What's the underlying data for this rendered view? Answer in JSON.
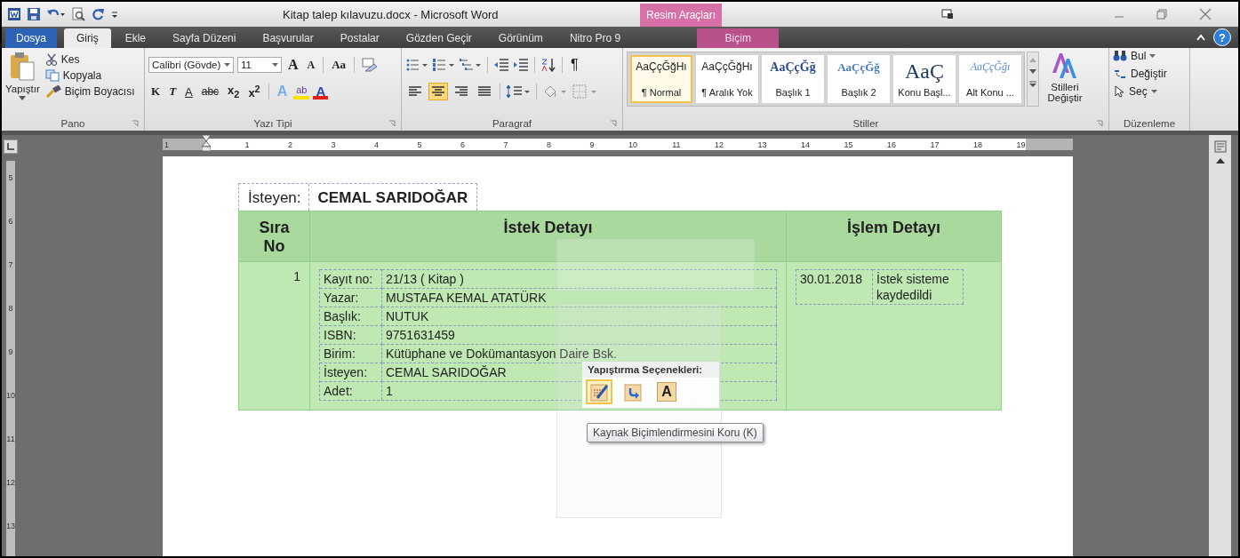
{
  "window": {
    "title": "Kitap talep kılavuzu.docx - Microsoft Word",
    "contextual_group": "Resim Araçları",
    "help": "?"
  },
  "tabs": [
    {
      "label": "Dosya",
      "kind": "file",
      "selected": false
    },
    {
      "label": "Giriş",
      "kind": "tab",
      "selected": true
    },
    {
      "label": "Ekle",
      "kind": "tab",
      "selected": false
    },
    {
      "label": "Sayfa Düzeni",
      "kind": "tab",
      "selected": false
    },
    {
      "label": "Başvurular",
      "kind": "tab",
      "selected": false
    },
    {
      "label": "Postalar",
      "kind": "tab",
      "selected": false
    },
    {
      "label": "Gözden Geçir",
      "kind": "tab",
      "selected": false
    },
    {
      "label": "Görünüm",
      "kind": "tab",
      "selected": false
    },
    {
      "label": "Nitro Pro 9",
      "kind": "tab",
      "selected": false
    },
    {
      "label": "Biçim",
      "kind": "contextual",
      "selected": false
    }
  ],
  "ribbon": {
    "clipboard": {
      "name": "Pano",
      "paste": "Yapıştır",
      "items": [
        "Kes",
        "Kopyala",
        "Biçim Boyacısı"
      ]
    },
    "font": {
      "name": "Yazı Tipi",
      "family": "Calibri (Gövde)",
      "size": "11",
      "row1": [
        "A",
        "A",
        "Aa"
      ],
      "row2": [
        "K",
        "T",
        "A",
        "abc",
        "x$_{2}$",
        "x$^{2}$"
      ],
      "row2b": [
        "A",
        "ab",
        "A"
      ]
    },
    "paragraph": {
      "name": "Paragraf",
      "pilcrow": "¶",
      "align": [
        {
          "kind": "left",
          "selected": false
        },
        {
          "kind": "center",
          "selected": true
        },
        {
          "kind": "right",
          "selected": false
        },
        {
          "kind": "justify",
          "selected": false
        }
      ]
    },
    "styles": {
      "name": "Stiller",
      "items": [
        {
          "preview": "AaÇçĞğHı",
          "label": "¶ Normal",
          "kind": "normal",
          "selected": true
        },
        {
          "preview": "AaÇçĞğHı",
          "label": "¶ Aralık Yok",
          "kind": "normal",
          "selected": false
        },
        {
          "preview": "AaÇçĞğ",
          "label": "Başlık 1",
          "kind": "heading1",
          "selected": false
        },
        {
          "preview": "AaÇçĞğ",
          "label": "Başlık 2",
          "kind": "heading2",
          "selected": false
        },
        {
          "preview": "AaÇ",
          "label": "Konu Başl...",
          "kind": "title",
          "selected": false
        },
        {
          "preview": "AaÇçĞğı",
          "label": "Alt Konu ...",
          "kind": "subtitle",
          "selected": false
        }
      ],
      "change": "Stilleri Değiştir"
    },
    "editing": {
      "name": "Düzenleme",
      "items": [
        "Bul",
        "Değiştir",
        "Seç"
      ]
    }
  },
  "ruler": {
    "negative": "1",
    "marks": [
      "1",
      "2",
      "3",
      "4",
      "5",
      "6",
      "7",
      "8",
      "9",
      "10",
      "11",
      "12",
      "13",
      "14",
      "15",
      "16",
      "17",
      "18",
      "19"
    ],
    "vertical": [
      "5",
      "6",
      "7",
      "8",
      "9",
      "10",
      "11",
      "12",
      "13"
    ]
  },
  "document": {
    "requester_label": "İsteyen:",
    "requester_value": "CEMAL SARIDOĞAR",
    "columns": [
      "Sıra No",
      "İstek Detayı",
      "İşlem Detayı"
    ],
    "rows": [
      {
        "no": "1",
        "details": [
          {
            "label": "Kayıt no:",
            "value": "21/13   ( Kitap )"
          },
          {
            "label": "Yazar:",
            "value": "MUSTAFA KEMAL ATATÜRK"
          },
          {
            "label": "Başlık:",
            "value": "NUTUK"
          },
          {
            "label": "ISBN:",
            "value": "9751631459"
          },
          {
            "label": "Birim:",
            "value": "Kütüphane ve Dokümantasyon Daire Bsk."
          },
          {
            "label": "İsteyen:",
            "value": "CEMAL SARIDOĞAR"
          },
          {
            "label": "Adet:",
            "value": "1"
          }
        ],
        "process": [
          {
            "date": "30.01.2018",
            "text": "İstek sisteme kaydedildi"
          }
        ]
      }
    ]
  },
  "paste_options": {
    "title": "Yapıştırma Seçenekleri:",
    "buttons": [
      {
        "kind": "keep-source",
        "selected": true
      },
      {
        "kind": "merge",
        "selected": false
      },
      {
        "kind": "text-only",
        "label": "A",
        "selected": false
      }
    ],
    "tooltip": "Kaynak Biçimlendirmesini Koru (K)"
  }
}
